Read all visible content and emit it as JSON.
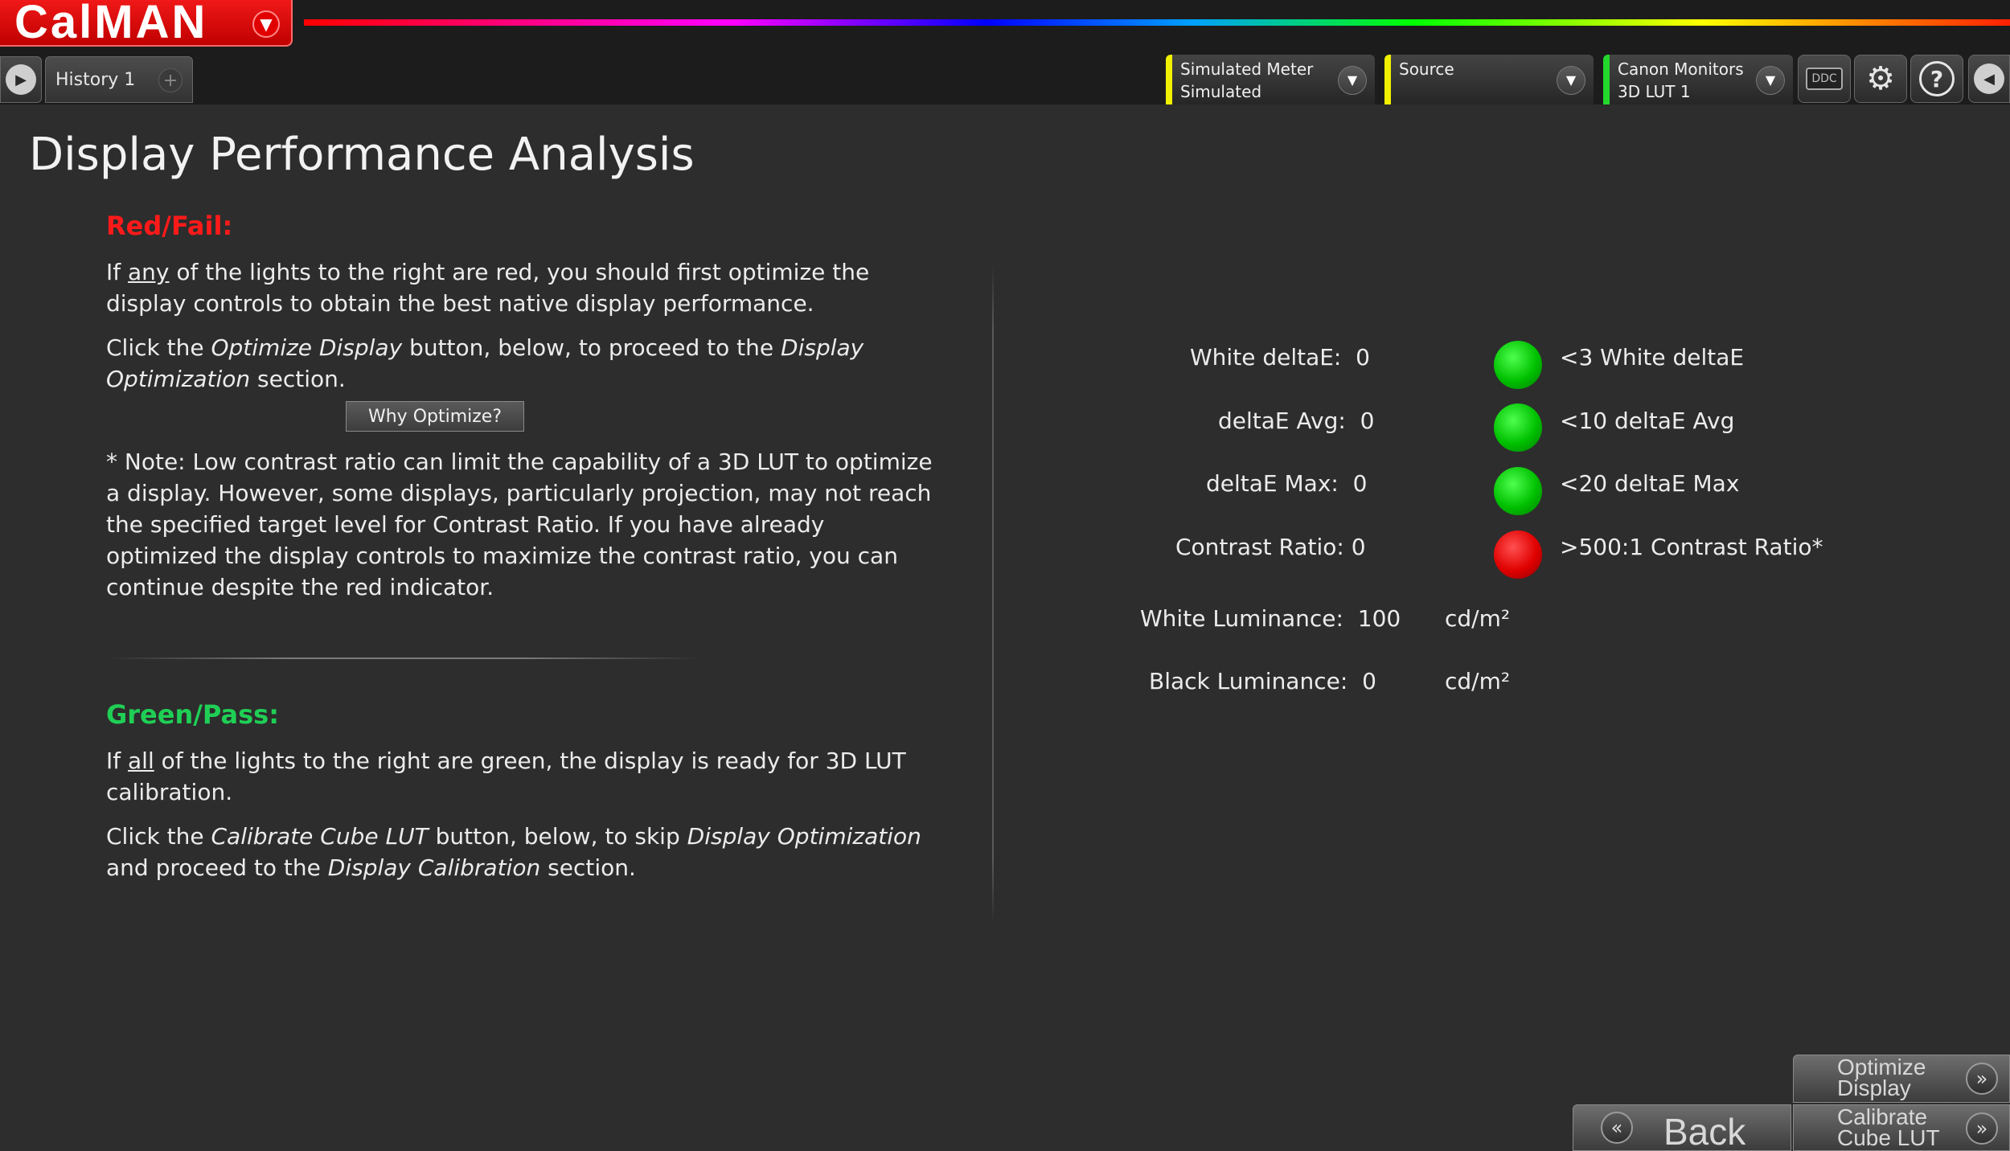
{
  "app": {
    "logo": "CalMAN"
  },
  "history_tab": {
    "label": "History 1",
    "add": "+"
  },
  "toolbar": {
    "meter": {
      "line1": "Simulated Meter",
      "line2": "Simulated"
    },
    "source": {
      "line1": "Source",
      "line2": ""
    },
    "display": {
      "line1": "Canon Monitors",
      "line2": "3D LUT 1"
    },
    "ddc_label": "DDC",
    "help_label": "?"
  },
  "page": {
    "title": "Display Performance Analysis"
  },
  "red_section": {
    "heading": "Red/Fail:",
    "p1_pre": "If ",
    "p1_u": "any",
    "p1_post": " of the lights to the right are red, you should first optimize the display controls to obtain the best native display performance.",
    "p2_a": "Click the ",
    "p2_b": "Optimize Display",
    "p2_c": " button, below, to proceed to the ",
    "p2_d": "Display Optimization",
    "p2_e": " section.",
    "why_button": "Why Optimize?",
    "note": "* Note: Low contrast ratio can limit the capability of a 3D LUT to optimize a display. However, some displays, particularly projection, may not reach the specified target level for Contrast Ratio.  If you have already optimized the display controls to maximize the contrast ratio, you can continue despite the red indicator."
  },
  "green_section": {
    "heading": "Green/Pass:",
    "p1_pre": "If ",
    "p1_u": "all",
    "p1_post": " of the lights to the right are green, the display is ready for 3D LUT calibration.",
    "p2_a": "Click the ",
    "p2_b": "Calibrate Cube LUT",
    "p2_c": " button, below, to skip ",
    "p2_d": "Display Optimization",
    "p2_e": " and proceed to the ",
    "p2_f": "Display Calibration",
    "p2_g": " section."
  },
  "metrics": {
    "white_deltae": {
      "label": "White deltaE:",
      "value": "0",
      "threshold": "<3 White deltaE",
      "status": "pass"
    },
    "deltae_avg": {
      "label": "deltaE Avg:",
      "value": "0",
      "threshold": "<10 deltaE Avg",
      "status": "pass"
    },
    "deltae_max": {
      "label": "deltaE Max:",
      "value": "0",
      "threshold": "<20 deltaE Max",
      "status": "pass"
    },
    "contrast_ratio": {
      "label": "Contrast Ratio:",
      "value": "0",
      "threshold": ">500:1 Contrast Ratio*",
      "status": "fail"
    },
    "white_luminance": {
      "label": "White Luminance:",
      "value": "100",
      "unit": "cd/m²"
    },
    "black_luminance": {
      "label": "Black Luminance:",
      "value": "0",
      "unit": "cd/m²"
    }
  },
  "bottom_buttons": {
    "optimize": {
      "line1": "Optimize",
      "line2": "Display"
    },
    "calibrate": {
      "line1": "Calibrate",
      "line2": "Cube LUT"
    },
    "back": "Back"
  },
  "colors": {
    "fail": "#ff1a1a",
    "pass": "#1fcf55",
    "accent_yellow": "#f1f000",
    "accent_green": "#23d82d"
  }
}
